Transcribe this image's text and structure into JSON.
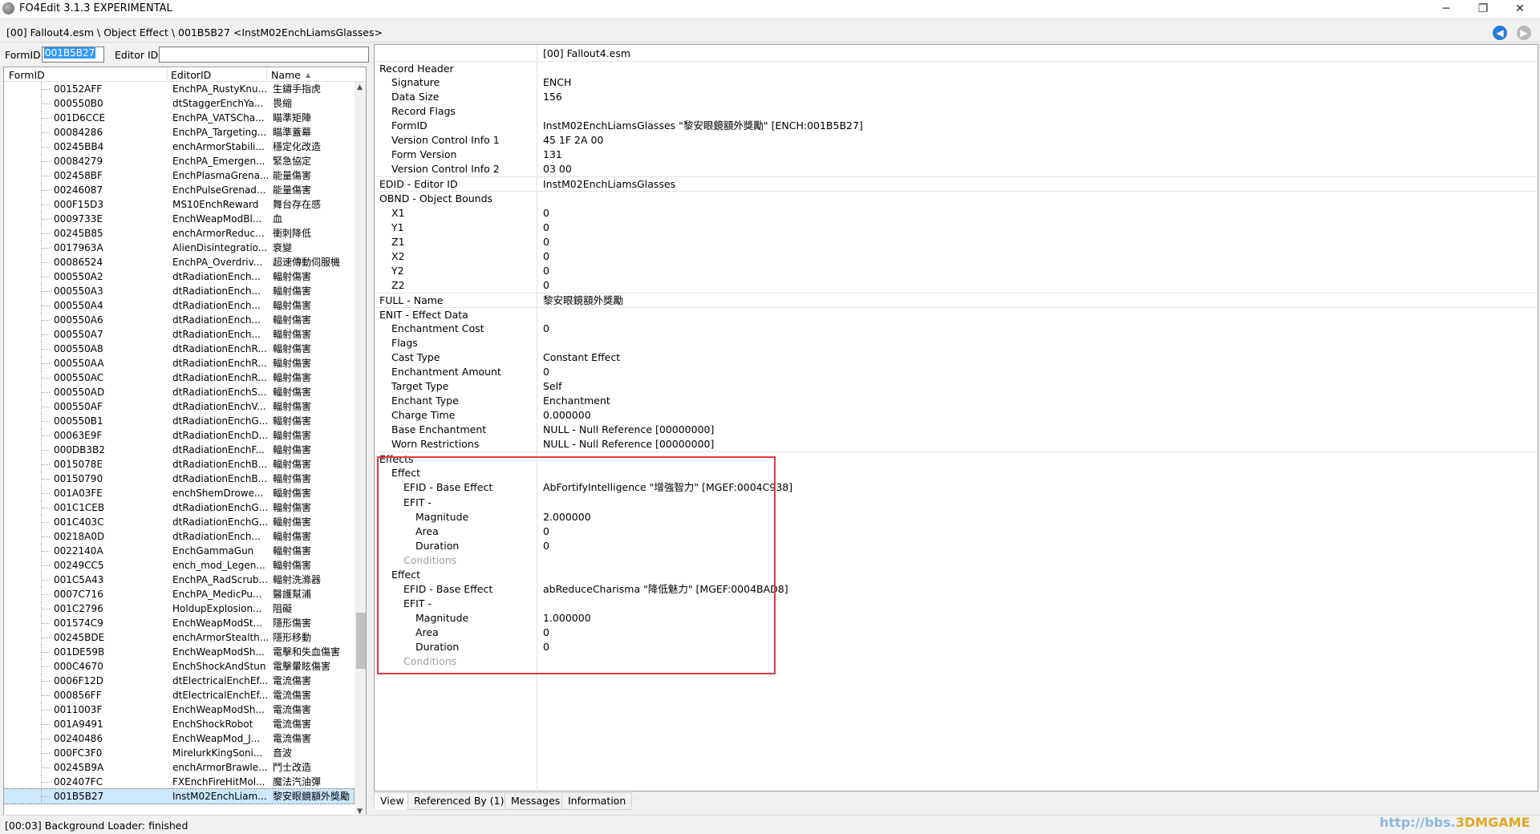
{
  "window": {
    "title": "FO4Edit 3.1.3 EXPERIMENTAL",
    "minimize": "─",
    "restore": "❐",
    "close": "✕"
  },
  "pathbar": {
    "path": "[00] Fallout4.esm \\ Object Effect \\ 001B5B27 <InstM02EnchLiamsGlasses>",
    "back_icon": "◀",
    "forward_icon": "▶"
  },
  "filter": {
    "formid_label": "FormID",
    "formid_value": "001B5B27",
    "editorid_label": "Editor ID",
    "editorid_value": ""
  },
  "tree": {
    "columns": [
      "FormID",
      "EditorID",
      "Name"
    ],
    "sort_icon": "▲",
    "rows": [
      [
        "00152AFF",
        "EnchPA_RustyKnu...",
        "生鏽手指虎"
      ],
      [
        "000550B0",
        "dtStaggerEnchYa...",
        "畏縮"
      ],
      [
        "001D6CCE",
        "EnchPA_VATSCha...",
        "瞄準矩陣"
      ],
      [
        "00084286",
        "EnchPA_Targeting...",
        "瞄準蓋幕"
      ],
      [
        "00245BB4",
        "enchArmorStabili...",
        "穩定化改造"
      ],
      [
        "00084279",
        "EnchPA_Emergen...",
        "緊急協定"
      ],
      [
        "002458BF",
        "EnchPlasmaGrena...",
        "能量傷害"
      ],
      [
        "00246087",
        "EnchPulseGrenad...",
        "能量傷害"
      ],
      [
        "000F15D3",
        "MS10EnchReward",
        "舞台存在感"
      ],
      [
        "0009733E",
        "EnchWeapModBl...",
        "血"
      ],
      [
        "00245B85",
        "enchArmorReduc...",
        "衝刺降低"
      ],
      [
        "0017963A",
        "AlienDisintegratio...",
        "衰變"
      ],
      [
        "00086524",
        "EnchPA_Overdriv...",
        "超速傳動伺服機"
      ],
      [
        "000550A2",
        "dtRadiationEnch...",
        "輻射傷害"
      ],
      [
        "000550A3",
        "dtRadiationEnch...",
        "輻射傷害"
      ],
      [
        "000550A4",
        "dtRadiationEnch...",
        "輻射傷害"
      ],
      [
        "000550A6",
        "dtRadiationEnch...",
        "輻射傷害"
      ],
      [
        "000550A7",
        "dtRadiationEnch...",
        "輻射傷害"
      ],
      [
        "000550A8",
        "dtRadiationEnchR...",
        "輻射傷害"
      ],
      [
        "000550AA",
        "dtRadiationEnchR...",
        "輻射傷害"
      ],
      [
        "000550AC",
        "dtRadiationEnchR...",
        "輻射傷害"
      ],
      [
        "000550AD",
        "dtRadiationEnchS...",
        "輻射傷害"
      ],
      [
        "000550AF",
        "dtRadiationEnchV...",
        "輻射傷害"
      ],
      [
        "000550B1",
        "dtRadiationEnchG...",
        "輻射傷害"
      ],
      [
        "00063E9F",
        "dtRadiationEnchD...",
        "輻射傷害"
      ],
      [
        "000DB3B2",
        "dtRadiationEnchF...",
        "輻射傷害"
      ],
      [
        "0015078E",
        "dtRadiationEnchB...",
        "輻射傷害"
      ],
      [
        "00150790",
        "dtRadiationEnchB...",
        "輻射傷害"
      ],
      [
        "001A03FE",
        "enchShemDrowe...",
        "輻射傷害"
      ],
      [
        "001C1CEB",
        "dtRadiationEnchG...",
        "輻射傷害"
      ],
      [
        "001C403C",
        "dtRadiationEnchG...",
        "輻射傷害"
      ],
      [
        "00218A0D",
        "dtRadiationEnch...",
        "輻射傷害"
      ],
      [
        "0022140A",
        "EnchGammaGun",
        "輻射傷害"
      ],
      [
        "00249CC5",
        "ench_mod_Legen...",
        "輻射傷害"
      ],
      [
        "001C5A43",
        "EnchPA_RadScrub...",
        "輻射洗滌器"
      ],
      [
        "0007C716",
        "EnchPA_MedicPu...",
        "醫護幫浦"
      ],
      [
        "001C2796",
        "HoldupExplosion...",
        "阻礙"
      ],
      [
        "001574C9",
        "EnchWeapModSt...",
        "隱形傷害"
      ],
      [
        "00245BDE",
        "enchArmorStealth...",
        "隱形移動"
      ],
      [
        "001DE59B",
        "EnchWeapModSh...",
        "電擊和失血傷害"
      ],
      [
        "000C4670",
        "EnchShockAndStun",
        "電擊暈眩傷害"
      ],
      [
        "0006F12D",
        "dtElectricalEnchEf...",
        "電流傷害"
      ],
      [
        "000856FF",
        "dtElectricalEnchEf...",
        "電流傷害"
      ],
      [
        "0011003F",
        "EnchWeapModSh...",
        "電流傷害"
      ],
      [
        "001A9491",
        "EnchShockRobot",
        "電流傷害"
      ],
      [
        "00240486",
        "EnchWeapMod_J...",
        "電流傷害"
      ],
      [
        "000FC3F0",
        "MirelurkKingSoni...",
        "音波"
      ],
      [
        "00245B9A",
        "enchArmorBrawle...",
        "鬥士改造"
      ],
      [
        "002407FC",
        "FXEnchFireHitMol...",
        "魔法汽油彈"
      ],
      [
        "001B5B27",
        "InstM02EnchLiam...",
        "黎安眼鏡額外獎勵"
      ]
    ]
  },
  "record": {
    "file_header": "[00] Fallout4.esm",
    "rows": [
      {
        "k": "Record Header",
        "v": "",
        "indent": 0,
        "sec": true
      },
      {
        "k": "Signature",
        "v": "ENCH",
        "indent": 1
      },
      {
        "k": "Data Size",
        "v": "156",
        "indent": 1
      },
      {
        "k": "Record Flags",
        "v": "",
        "indent": 1
      },
      {
        "k": "FormID",
        "v": "InstM02EnchLiamsGlasses \"黎安眼鏡額外獎勵\" [ENCH:001B5B27]",
        "indent": 1
      },
      {
        "k": "Version Control Info 1",
        "v": "45 1F 2A 00",
        "indent": 1
      },
      {
        "k": "Form Version",
        "v": "131",
        "indent": 1
      },
      {
        "k": "Version Control Info 2",
        "v": "03 00",
        "indent": 1
      },
      {
        "k": "EDID - Editor ID",
        "v": "InstM02EnchLiamsGlasses",
        "indent": 0,
        "sec": true
      },
      {
        "k": "OBND - Object Bounds",
        "v": "",
        "indent": 0,
        "sec": true
      },
      {
        "k": "X1",
        "v": "0",
        "indent": 1
      },
      {
        "k": "Y1",
        "v": "0",
        "indent": 1
      },
      {
        "k": "Z1",
        "v": "0",
        "indent": 1
      },
      {
        "k": "X2",
        "v": "0",
        "indent": 1
      },
      {
        "k": "Y2",
        "v": "0",
        "indent": 1
      },
      {
        "k": "Z2",
        "v": "0",
        "indent": 1
      },
      {
        "k": "FULL - Name",
        "v": "黎安眼鏡額外獎勵",
        "indent": 0,
        "sec": true
      },
      {
        "k": "ENIT - Effect Data",
        "v": "",
        "indent": 0,
        "sec": true
      },
      {
        "k": "Enchantment Cost",
        "v": "0",
        "indent": 1
      },
      {
        "k": "Flags",
        "v": "",
        "indent": 1
      },
      {
        "k": "Cast Type",
        "v": "Constant Effect",
        "indent": 1
      },
      {
        "k": "Enchantment Amount",
        "v": "0",
        "indent": 1
      },
      {
        "k": "Target Type",
        "v": "Self",
        "indent": 1
      },
      {
        "k": "Enchant Type",
        "v": "Enchantment",
        "indent": 1
      },
      {
        "k": "Charge Time",
        "v": "0.000000",
        "indent": 1
      },
      {
        "k": "Base Enchantment",
        "v": "NULL - Null Reference [00000000]",
        "indent": 1
      },
      {
        "k": "Worn Restrictions",
        "v": "NULL - Null Reference [00000000]",
        "indent": 1
      },
      {
        "k": "Effects",
        "v": "",
        "indent": 0,
        "sec": true
      },
      {
        "k": "Effect",
        "v": "",
        "indent": 1
      },
      {
        "k": "EFID - Base Effect",
        "v": "AbFortifyIntelligence \"增強智力\" [MGEF:0004C938]",
        "indent": 2
      },
      {
        "k": "EFIT -",
        "v": "",
        "indent": 2
      },
      {
        "k": "Magnitude",
        "v": "2.000000",
        "indent": 3
      },
      {
        "k": "Area",
        "v": "0",
        "indent": 3
      },
      {
        "k": "Duration",
        "v": "0",
        "indent": 3
      },
      {
        "k": "Conditions",
        "v": "",
        "indent": 2,
        "dim": true
      },
      {
        "k": "Effect",
        "v": "",
        "indent": 1
      },
      {
        "k": "EFID - Base Effect",
        "v": "abReduceCharisma \"降低魅力\" [MGEF:0004BAD8]",
        "indent": 2
      },
      {
        "k": "EFIT -",
        "v": "",
        "indent": 2
      },
      {
        "k": "Magnitude",
        "v": "1.000000",
        "indent": 3
      },
      {
        "k": "Area",
        "v": "0",
        "indent": 3
      },
      {
        "k": "Duration",
        "v": "0",
        "indent": 3
      },
      {
        "k": "Conditions",
        "v": "",
        "indent": 2,
        "dim": true
      }
    ]
  },
  "tabs": [
    "View",
    "Referenced By (1)",
    "Messages",
    "Information"
  ],
  "status": "[00:03] Background Loader: finished",
  "watermark": {
    "url": "http://bbs.",
    "brand": "3DMGAME"
  }
}
